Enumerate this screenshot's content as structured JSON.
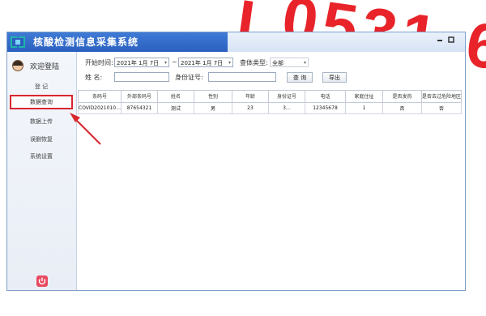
{
  "overlay": {
    "text": "i 0531-6"
  },
  "window": {
    "title": "核酸检测信息采集系统",
    "colors": {
      "titlebar": "#2a5fbf",
      "highlight": "#d8262d"
    }
  },
  "sidebar": {
    "welcome": "欢迎登陆",
    "items": [
      {
        "label": "登 记"
      },
      {
        "label": "数据查询"
      },
      {
        "label": "数据上传"
      },
      {
        "label": "误删恢复"
      },
      {
        "label": "系统设置"
      }
    ]
  },
  "filters": {
    "start_label": "开始时间:",
    "start_value": "2021年  1月  7日",
    "sep": "~",
    "end_value": "2021年  1月  7日",
    "type_label": "查体类型:",
    "type_value": "全部",
    "name_label": "姓    名:",
    "name_value": "",
    "id_label": "身份证号:",
    "id_value": "",
    "query_btn": "查 询",
    "export_btn": "导出"
  },
  "table": {
    "headers": [
      "条码号",
      "外部条码号",
      "姓名",
      "性别",
      "年龄",
      "身份证号",
      "电话",
      "家庭住址",
      "是否发热",
      "是否去过危险地区"
    ],
    "rows": [
      [
        "COVID2021010…",
        "87654321",
        "测试",
        "男",
        "23",
        "3…",
        "12345678",
        "1",
        "否",
        "否"
      ]
    ]
  }
}
